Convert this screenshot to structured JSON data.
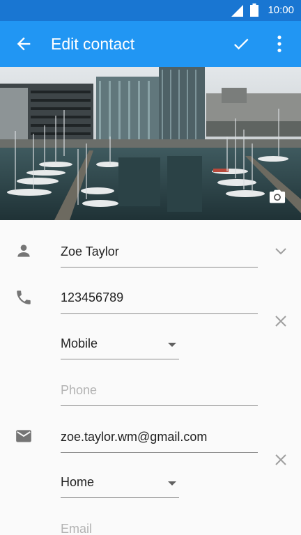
{
  "status_bar": {
    "time": "10:00"
  },
  "app_bar": {
    "title": "Edit contact"
  },
  "contact": {
    "name": "Zoe Taylor",
    "phone": {
      "value": "123456789",
      "type": "Mobile",
      "placeholder": "Phone"
    },
    "email": {
      "value": "zoe.taylor.wm@gmail.com",
      "type": "Home",
      "placeholder": "Email"
    }
  },
  "icons": {
    "back": "arrow-back-icon",
    "save": "check-icon",
    "menu": "more-vert-icon",
    "camera": "camera-icon",
    "person": "person-icon",
    "phone": "phone-icon",
    "email": "email-icon",
    "expand": "chevron-down-icon",
    "remove": "close-icon"
  },
  "colors": {
    "status_bar": "#1976d2",
    "app_bar": "#2196f3",
    "background": "#fafafa"
  }
}
